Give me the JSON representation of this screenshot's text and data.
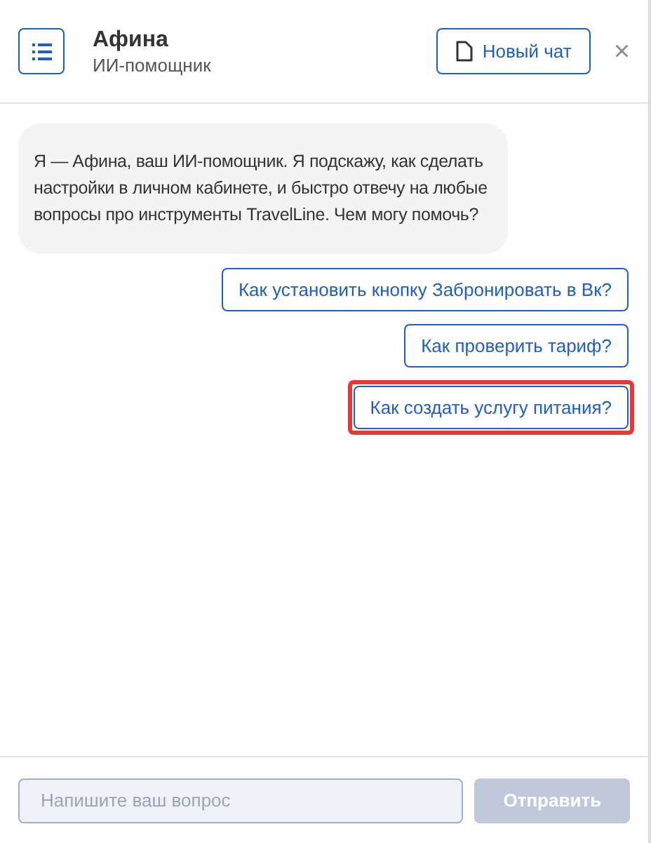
{
  "header": {
    "title": "Афина",
    "subtitle": "ИИ-помощник",
    "new_chat_button": "Новый чат",
    "close": "×"
  },
  "messages": [
    {
      "text": "Я — Афина, ваш ИИ-помощник. Я подскажу, как сделать настройки в личном кабинете, и быстро отвечу на любые вопросы про инструменты TravelLine. Чем могу помочь?"
    }
  ],
  "suggestions": [
    {
      "label": "Как установить кнопку Забронировать в Вк?",
      "highlighted": false
    },
    {
      "label": "Как проверить тариф?",
      "highlighted": false
    },
    {
      "label": "Как создать услугу питания?",
      "highlighted": true
    }
  ],
  "composer": {
    "placeholder": "Напишите ваш вопрос",
    "send_button": "Отправить",
    "send_disabled": true
  }
}
